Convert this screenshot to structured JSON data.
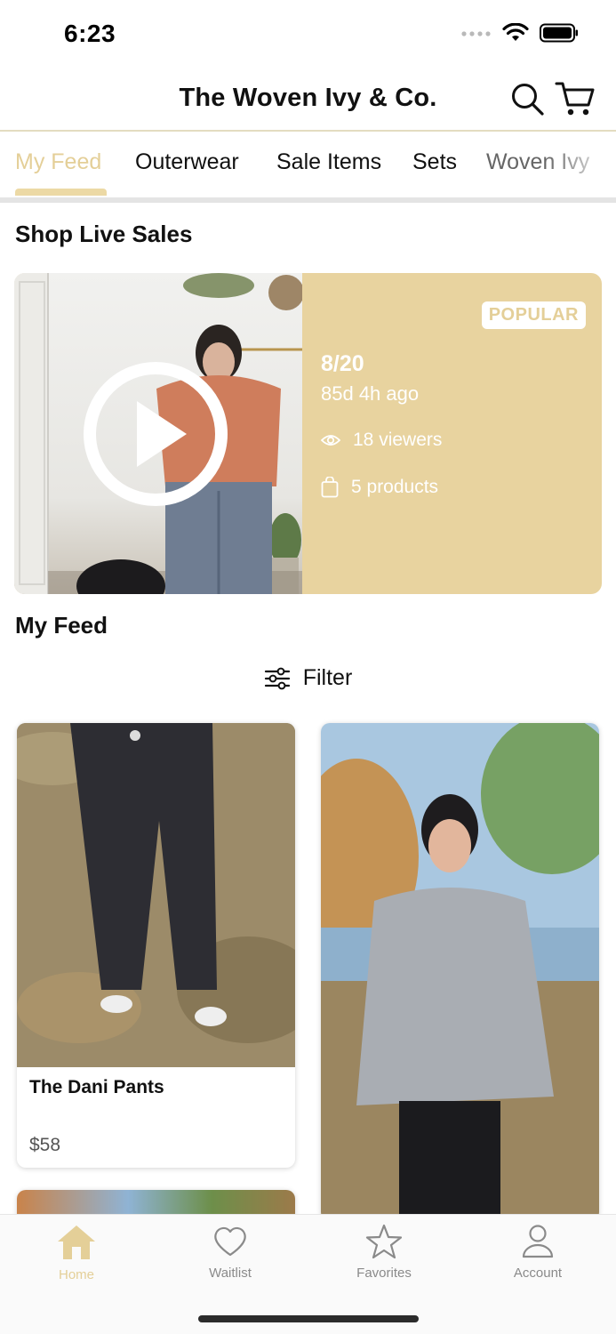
{
  "status_bar": {
    "time": "6:23"
  },
  "header": {
    "title": "The Woven Ivy & Co."
  },
  "category_tabs": [
    {
      "label": "My Feed",
      "active": true
    },
    {
      "label": "Outerwear",
      "active": false
    },
    {
      "label": "Sale Items",
      "active": false
    },
    {
      "label": "Sets",
      "active": false
    },
    {
      "label": "Woven Ivy",
      "active": false
    }
  ],
  "live_sales": {
    "section_title": "Shop Live Sales",
    "card": {
      "badge": "POPULAR",
      "date": "8/20",
      "ago": "85d 4h ago",
      "viewers": "18 viewers",
      "products": "5 products"
    }
  },
  "feed": {
    "section_title": "My Feed",
    "filter_label": "Filter",
    "products": [
      {
        "name": "The Dani Pants",
        "price": "$58"
      }
    ]
  },
  "bottom_nav": [
    {
      "label": "Home",
      "icon": "home-icon",
      "active": true
    },
    {
      "label": "Waitlist",
      "icon": "heart-icon",
      "active": false
    },
    {
      "label": "Favorites",
      "icon": "star-icon",
      "active": false
    },
    {
      "label": "Account",
      "icon": "person-icon",
      "active": false
    }
  ],
  "colors": {
    "accent": "#e4cf98",
    "card_bg": "#e8d39f",
    "text": "#111111",
    "muted": "#8a8a8a"
  }
}
